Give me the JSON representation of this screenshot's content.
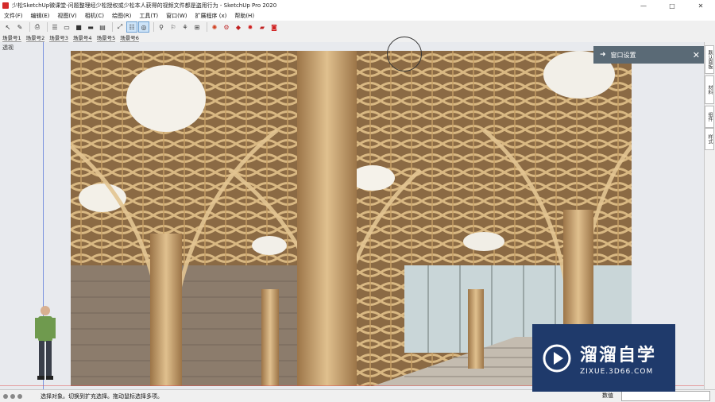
{
  "window": {
    "title": "少松SketchUp微课堂-问题整理经少松授权或少松本人获得的视频文件都是盗用行为 - SketchUp Pro 2020",
    "controls": [
      "—",
      "□",
      "✕"
    ]
  },
  "menu": [
    "文件(F)",
    "编辑(E)",
    "视图(V)",
    "相机(C)",
    "绘图(R)",
    "工具(T)",
    "窗口(W)",
    "扩展程序 (x)",
    "帮助(H)"
  ],
  "toolbar": {
    "icons": [
      "select-icon",
      "eraser-icon",
      "sep",
      "print-icon",
      "sep",
      "view-1-icon",
      "view-2-icon",
      "view-3-icon",
      "view-4-icon",
      "view-5-icon",
      "sep",
      "zoom-extents-icon",
      "camera-active-icon",
      "orbit-active-icon",
      "sep",
      "walk-icon",
      "look-icon",
      "section-icon",
      "component-icon",
      "sep",
      "gear-1-icon",
      "gear-2-icon",
      "ruby-1-icon",
      "ruby-2-icon",
      "ruby-3-icon",
      "ruby-4-icon"
    ]
  },
  "scenes": [
    "场景号1",
    "场景号2",
    "场景号3",
    "场景号4",
    "场景号5",
    "场景号6"
  ],
  "viewport": {
    "label": "透视"
  },
  "panel": {
    "title": "窗口设置"
  },
  "dock_tabs": [
    "默认面板",
    "材料",
    "组件",
    "样式"
  ],
  "status": {
    "message": "选择对象。切换到扩充选择。拖动鼠标选择多项。",
    "measure_label": "数值"
  },
  "watermark": {
    "name": "溜溜自学",
    "url": "ZIXUE.3D66.COM"
  },
  "colors": {
    "panel_header": "#5a6a76",
    "watermark_bg": "#1f3a6b",
    "axis_blue": "#5b7bd9"
  }
}
